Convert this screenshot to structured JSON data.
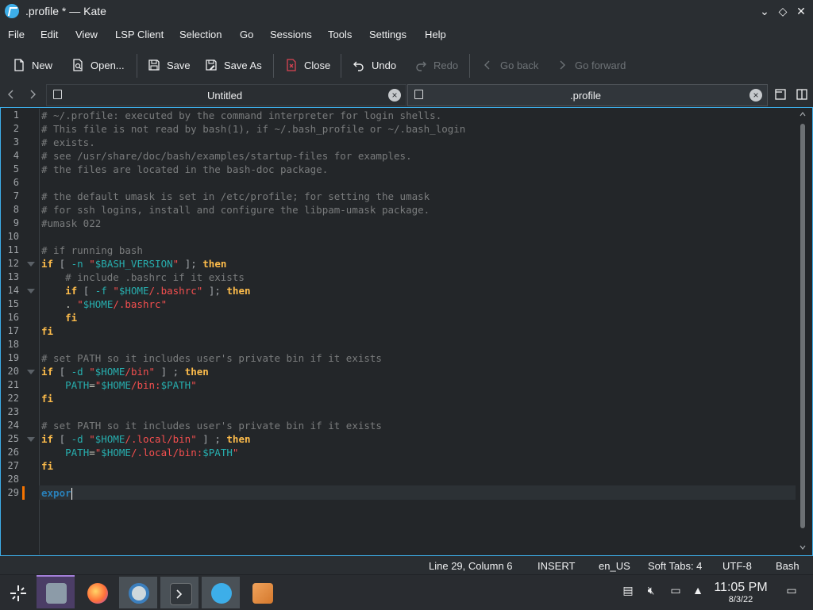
{
  "window": {
    "title": ".profile * — Kate"
  },
  "menu": [
    "File",
    "Edit",
    "View",
    "LSP Client",
    "Selection",
    "Go",
    "Sessions",
    "Tools",
    "Settings",
    "Help"
  ],
  "toolbar": {
    "new_label": "New",
    "open_label": "Open...",
    "save_label": "Save",
    "save_as_label": "Save As",
    "close_label": "Close",
    "undo_label": "Undo",
    "redo_label": "Redo",
    "go_back_label": "Go back",
    "go_forward_label": "Go forward"
  },
  "tabs": [
    {
      "label": "Untitled",
      "active": false
    },
    {
      "label": ".profile",
      "active": true
    }
  ],
  "editor": {
    "current_line": 29,
    "lines": [
      "# ~/.profile: executed by the command interpreter for login shells.",
      "# This file is not read by bash(1), if ~/.bash_profile or ~/.bash_login",
      "# exists.",
      "# see /usr/share/doc/bash/examples/startup-files for examples.",
      "# the files are located in the bash-doc package.",
      "",
      "# the default umask is set in /etc/profile; for setting the umask",
      "# for ssh logins, install and configure the libpam-umask package.",
      "#umask 022",
      "",
      "# if running bash",
      "if [ -n \"$BASH_VERSION\" ]; then",
      "    # include .bashrc if it exists",
      "    if [ -f \"$HOME/.bashrc\" ]; then",
      "    . \"$HOME/.bashrc\"",
      "    fi",
      "fi",
      "",
      "# set PATH so it includes user's private bin if it exists",
      "if [ -d \"$HOME/bin\" ] ; then",
      "    PATH=\"$HOME/bin:$PATH\"",
      "fi",
      "",
      "# set PATH so it includes user's private bin if it exists",
      "if [ -d \"$HOME/.local/bin\" ] ; then",
      "    PATH=\"$HOME/.local/bin:$PATH\"",
      "fi",
      "",
      "expor"
    ]
  },
  "status": {
    "position": "Line 29, Column 6",
    "mode": "INSERT",
    "dictionary": "en_US",
    "indent": "Soft Tabs: 4",
    "encoding": "UTF-8",
    "syntax": "Bash"
  },
  "taskbar": {
    "time": "11:05 PM",
    "date": "8/3/22"
  },
  "colors": {
    "accent": "#3daee9",
    "keyword": "#fdbc4b",
    "string": "#f44f4f",
    "variable": "#27aeae",
    "comment": "#7a7c7d",
    "modified_marker": "#f67400"
  }
}
